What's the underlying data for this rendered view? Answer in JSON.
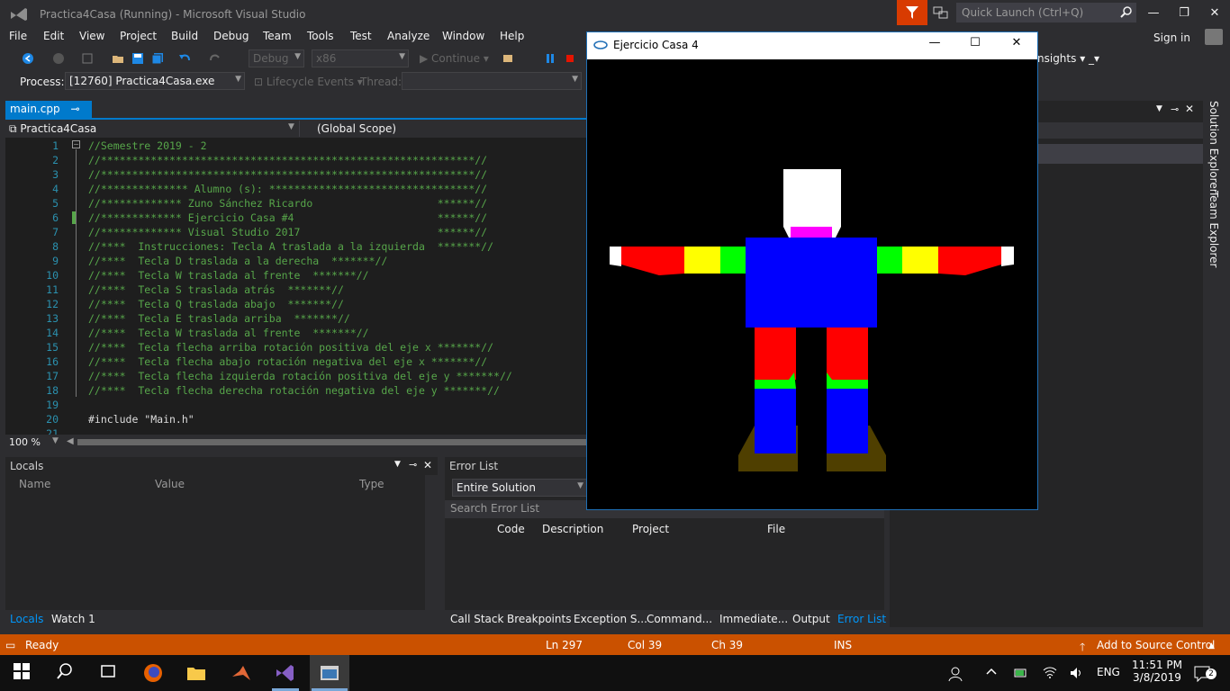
{
  "titlebar": {
    "title": "Practica4Casa (Running) - Microsoft Visual Studio",
    "quick_launch_placeholder": "Quick Launch (Ctrl+Q)",
    "minimize": "—",
    "restore": "❐",
    "close": "✕"
  },
  "menu": {
    "items": [
      "File",
      "Edit",
      "View",
      "Project",
      "Build",
      "Debug",
      "Team",
      "Tools",
      "Test",
      "Analyze",
      "Window",
      "Help"
    ],
    "signin": "Sign in"
  },
  "toolbar": {
    "config": "Debug",
    "platform": "x86",
    "continue": "Continue",
    "insights": "nsights"
  },
  "process_bar": {
    "label": "Process:",
    "process": "[12760] Practica4Casa.exe",
    "lifecycle": "Lifecycle Events",
    "thread_label": "Thread:"
  },
  "editor": {
    "tab": "main.cpp",
    "project_combo": "Practica4Casa",
    "scope_combo": "(Global Scope)",
    "zoom": "100 %",
    "lines": [
      {
        "n": "1",
        "t": "//Semestre 2019 - 2"
      },
      {
        "n": "2",
        "t": "//************************************************************//"
      },
      {
        "n": "3",
        "t": "//************************************************************//"
      },
      {
        "n": "4",
        "t": "//************** Alumno (s): *********************************//"
      },
      {
        "n": "5",
        "t": "//************* Zuno Sánchez Ricardo                    ******//"
      },
      {
        "n": "6",
        "t": "//************* Ejercicio Casa #4                       ******//"
      },
      {
        "n": "7",
        "t": "//************* Visual Studio 2017                      ******//"
      },
      {
        "n": "8",
        "t": "//****  Instrucciones: Tecla A traslada a la izquierda  *******//"
      },
      {
        "n": "9",
        "t": "//****  Tecla D traslada a la derecha  *******//"
      },
      {
        "n": "10",
        "t": "//****  Tecla W traslada al frente  *******//"
      },
      {
        "n": "11",
        "t": "//****  Tecla S traslada atrás  *******//"
      },
      {
        "n": "12",
        "t": "//****  Tecla Q traslada abajo  *******//"
      },
      {
        "n": "13",
        "t": "//****  Tecla E traslada arriba  *******//"
      },
      {
        "n": "14",
        "t": "//****  Tecla W traslada al frente  *******//"
      },
      {
        "n": "15",
        "t": "//****  Tecla flecha arriba rotación positiva del eje x *******//"
      },
      {
        "n": "16",
        "t": "//****  Tecla flecha abajo rotación negativa del eje x *******//"
      },
      {
        "n": "17",
        "t": "//****  Tecla flecha izquierda rotación positiva del eje y *******//"
      },
      {
        "n": "18",
        "t": "//****  Tecla flecha derecha rotación negativa del eje y *******//"
      },
      {
        "n": "19",
        "t": ""
      },
      {
        "n": "20",
        "t": "#include \"Main.h\""
      },
      {
        "n": "21",
        "t": ""
      }
    ]
  },
  "locals": {
    "title": "Locals",
    "columns": [
      "Name",
      "Value",
      "Type"
    ]
  },
  "error_list": {
    "title": "Error List",
    "scope": "Entire Solution",
    "search_placeholder": "Search Error List",
    "columns": [
      "Code",
      "Description",
      "Project",
      "File"
    ]
  },
  "bottom_tabs_left": [
    "Locals",
    "Watch 1"
  ],
  "bottom_tabs_right": [
    "Call Stack",
    "Breakpoints",
    "Exception S...",
    "Command...",
    "Immediate...",
    "Output",
    "Error List"
  ],
  "side_tabs": [
    "Solution Explorer",
    "Team Explorer"
  ],
  "status": {
    "ready": "Ready",
    "ln": "Ln 297",
    "col": "Col 39",
    "ch": "Ch 39",
    "ins": "INS",
    "source_control": "Add to Source Control"
  },
  "popup": {
    "title": "Ejercicio Casa 4"
  },
  "taskbar": {
    "lang": "ENG",
    "time": "11:51 PM",
    "date": "3/8/2019",
    "notifications": "2"
  },
  "colors": {
    "accent": "#007acc",
    "status_bar": "#ca5100",
    "filter_button": "#d83b01"
  }
}
